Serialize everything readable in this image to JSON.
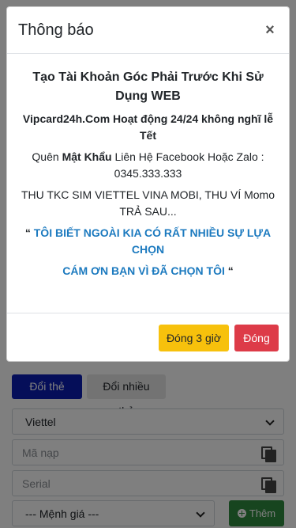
{
  "background": {
    "tabs": [
      "Đổi thẻ cào",
      "Đổi nhiều thẻ"
    ],
    "carrier_select": "Viettel",
    "code_placeholder": "Mã nạp",
    "serial_placeholder": "Serial",
    "denomination_select": "--- Mệnh giá ---",
    "add_button": "Thêm"
  },
  "modal": {
    "title": "Thông báo",
    "close": "×",
    "line1": "Tạo Tài Khoản Góc Phải Trước Khi Sử Dụng WEB",
    "line2": "Vipcard24h.Com Hoạt động 24/24 không nghĩ lễ Tết",
    "line3_prefix": "Quên ",
    "line3_bold": "Mật Khẩu",
    "line3_suffix": " Liên Hệ Facebook Hoặc Zalo : 0345.333.333",
    "line4": "THU TKC SIM VIETTEL VINA MOBI, THU VÍ Momo TRẢ SAU...",
    "quote_open": "“ ",
    "blue1": "TÔI BIẾT NGOÀI KIA CÓ RẤT NHIỀU SỰ LỰA CHỌN",
    "blue2": "CÁM ƠN BẠN VÌ ĐÃ CHỌN TÔI",
    "quote_close": " “",
    "btn_snooze": "Đóng 3 giờ",
    "btn_close": "Đóng"
  },
  "colors": {
    "primary": "#0b1db3",
    "warning": "#f7c10c",
    "danger": "#dd3b48",
    "success": "#2f8a3e",
    "link": "#1c7abf"
  }
}
